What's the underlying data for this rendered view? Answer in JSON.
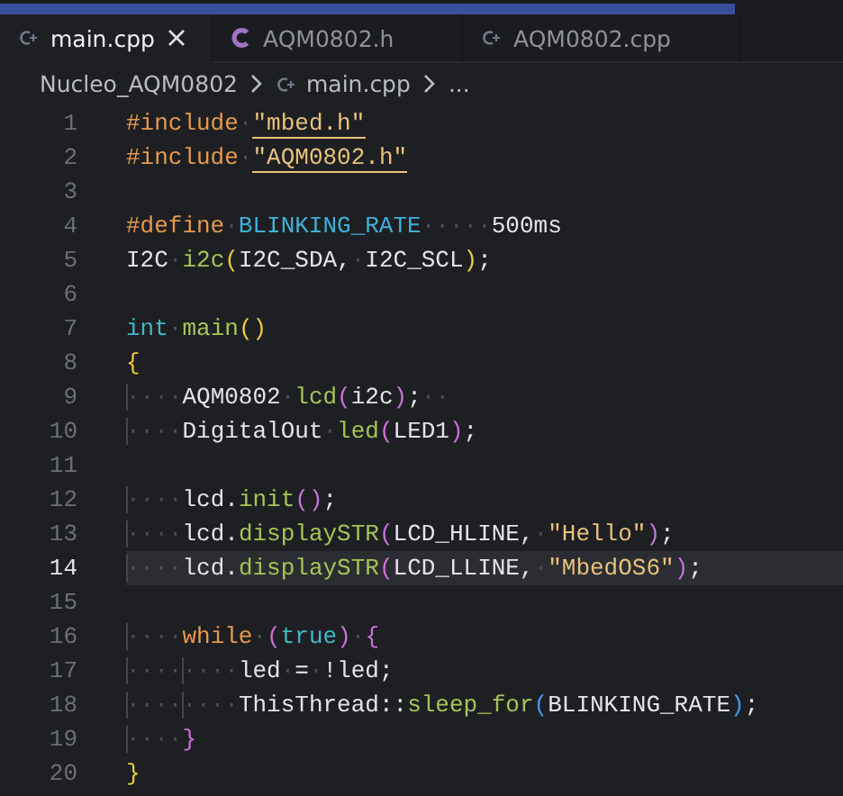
{
  "tabs": [
    {
      "label": "main.cpp",
      "kind": "source",
      "selected": true
    },
    {
      "label": "AQM0802.h",
      "kind": "header",
      "selected": false
    },
    {
      "label": "AQM0802.cpp",
      "kind": "source",
      "selected": false
    }
  ],
  "breadcrumb": [
    {
      "label": "Nucleo_AQM0802",
      "kind": "folder"
    },
    {
      "label": "main.cpp",
      "kind": "source"
    },
    {
      "label": "...",
      "kind": "symbol"
    }
  ],
  "lines": [
    {
      "number": "1",
      "current": false,
      "tokens": [
        {
          "text": "#include",
          "kind": "directive"
        },
        {
          "text": "·",
          "kind": "ws"
        },
        {
          "text": "\"mbed.h\"",
          "kind": "include-path"
        }
      ]
    },
    {
      "number": "2",
      "current": false,
      "tokens": [
        {
          "text": "#include",
          "kind": "directive"
        },
        {
          "text": "·",
          "kind": "ws"
        },
        {
          "text": "\"AQM0802.h\"",
          "kind": "include-path"
        }
      ]
    },
    {
      "number": "3",
      "current": false
    },
    {
      "number": "4",
      "current": false,
      "tokens": [
        {
          "text": "#define",
          "kind": "directive"
        },
        {
          "text": "·",
          "kind": "ws"
        },
        {
          "text": "BLINKING_RATE",
          "kind": "macro"
        },
        {
          "text": "·····",
          "kind": "ws"
        },
        {
          "text": "500ms",
          "kind": "plain"
        }
      ]
    },
    {
      "number": "5",
      "current": false,
      "tokens": [
        {
          "text": "I2C",
          "kind": "plain"
        },
        {
          "text": "·",
          "kind": "ws"
        },
        {
          "text": "i2c",
          "kind": "function"
        },
        {
          "text": "(",
          "kind": "bracket1"
        },
        {
          "text": "I2C_SDA,",
          "kind": "plain"
        },
        {
          "text": "·",
          "kind": "ws"
        },
        {
          "text": "I2C_SCL",
          "kind": "plain"
        },
        {
          "text": ")",
          "kind": "bracket1"
        },
        {
          "text": ";",
          "kind": "plain"
        }
      ]
    },
    {
      "number": "6",
      "current": false
    },
    {
      "number": "7",
      "current": false,
      "tokens": [
        {
          "text": "int",
          "kind": "type"
        },
        {
          "text": "·",
          "kind": "ws"
        },
        {
          "text": "main",
          "kind": "function"
        },
        {
          "text": "()",
          "kind": "bracket1"
        }
      ]
    },
    {
      "number": "8",
      "current": false,
      "tokens": [
        {
          "text": "{",
          "kind": "bracket1"
        }
      ]
    },
    {
      "number": "9",
      "current": false,
      "tokens": [
        {
          "text": "····",
          "kind": "indent"
        },
        {
          "text": "AQM0802",
          "kind": "plain"
        },
        {
          "text": "·",
          "kind": "ws"
        },
        {
          "text": "lcd",
          "kind": "function"
        },
        {
          "text": "(",
          "kind": "bracket2"
        },
        {
          "text": "i2c",
          "kind": "plain"
        },
        {
          "text": ")",
          "kind": "bracket2"
        },
        {
          "text": ";",
          "kind": "plain"
        },
        {
          "text": "··",
          "kind": "ws"
        }
      ]
    },
    {
      "number": "10",
      "current": false,
      "tokens": [
        {
          "text": "····",
          "kind": "indent"
        },
        {
          "text": "DigitalOut",
          "kind": "plain"
        },
        {
          "text": "·",
          "kind": "ws"
        },
        {
          "text": "led",
          "kind": "function"
        },
        {
          "text": "(",
          "kind": "bracket2"
        },
        {
          "text": "LED1",
          "kind": "plain"
        },
        {
          "text": ")",
          "kind": "bracket2"
        },
        {
          "text": ";",
          "kind": "plain"
        }
      ]
    },
    {
      "number": "11",
      "current": false
    },
    {
      "number": "12",
      "current": false,
      "tokens": [
        {
          "text": "····",
          "kind": "indent"
        },
        {
          "text": "lcd.",
          "kind": "plain"
        },
        {
          "text": "init",
          "kind": "function"
        },
        {
          "text": "()",
          "kind": "bracket2"
        },
        {
          "text": ";",
          "kind": "plain"
        }
      ]
    },
    {
      "number": "13",
      "current": false,
      "tokens": [
        {
          "text": "····",
          "kind": "indent"
        },
        {
          "text": "lcd.",
          "kind": "plain"
        },
        {
          "text": "displaySTR",
          "kind": "function"
        },
        {
          "text": "(",
          "kind": "bracket2"
        },
        {
          "text": "LCD_HLINE,",
          "kind": "plain"
        },
        {
          "text": "·",
          "kind": "ws"
        },
        {
          "text": "\"Hello\"",
          "kind": "string"
        },
        {
          "text": ")",
          "kind": "bracket2"
        },
        {
          "text": ";",
          "kind": "plain"
        }
      ]
    },
    {
      "number": "14",
      "current": true,
      "tokens": [
        {
          "text": "····",
          "kind": "indent"
        },
        {
          "text": "lcd.",
          "kind": "plain"
        },
        {
          "text": "displaySTR",
          "kind": "function"
        },
        {
          "text": "(",
          "kind": "bracket2"
        },
        {
          "text": "LCD_LLINE,",
          "kind": "plain"
        },
        {
          "text": "·",
          "kind": "ws"
        },
        {
          "text": "\"MbedOS6\"",
          "kind": "string"
        },
        {
          "text": ")",
          "kind": "bracket2"
        },
        {
          "text": ";",
          "kind": "plain"
        }
      ]
    },
    {
      "number": "15",
      "current": false
    },
    {
      "number": "16",
      "current": false,
      "tokens": [
        {
          "text": "····",
          "kind": "indent"
        },
        {
          "text": "while",
          "kind": "keyword"
        },
        {
          "text": "·",
          "kind": "ws"
        },
        {
          "text": "(",
          "kind": "bracket2"
        },
        {
          "text": "true",
          "kind": "type"
        },
        {
          "text": ")",
          "kind": "bracket2"
        },
        {
          "text": "·",
          "kind": "ws"
        },
        {
          "text": "{",
          "kind": "bracket2"
        }
      ]
    },
    {
      "number": "17",
      "current": false,
      "tokens": [
        {
          "text": "····",
          "kind": "indent"
        },
        {
          "text": "····",
          "kind": "indent"
        },
        {
          "text": "led",
          "kind": "plain"
        },
        {
          "text": "·",
          "kind": "ws"
        },
        {
          "text": "=",
          "kind": "plain"
        },
        {
          "text": "·",
          "kind": "ws"
        },
        {
          "text": "!led;",
          "kind": "plain"
        }
      ]
    },
    {
      "number": "18",
      "current": false,
      "tokens": [
        {
          "text": "····",
          "kind": "indent"
        },
        {
          "text": "····",
          "kind": "indent"
        },
        {
          "text": "ThisThread::",
          "kind": "plain"
        },
        {
          "text": "sleep_for",
          "kind": "function"
        },
        {
          "text": "(",
          "kind": "bracket3"
        },
        {
          "text": "BLINKING_RATE",
          "kind": "plain"
        },
        {
          "text": ")",
          "kind": "bracket3"
        },
        {
          "text": ";",
          "kind": "plain"
        }
      ]
    },
    {
      "number": "19",
      "current": false,
      "tokens": [
        {
          "text": "····",
          "kind": "indent"
        },
        {
          "text": "}",
          "kind": "bracket2"
        }
      ]
    },
    {
      "number": "20",
      "current": false,
      "tokens": [
        {
          "text": "}",
          "kind": "bracket1"
        }
      ]
    }
  ]
}
